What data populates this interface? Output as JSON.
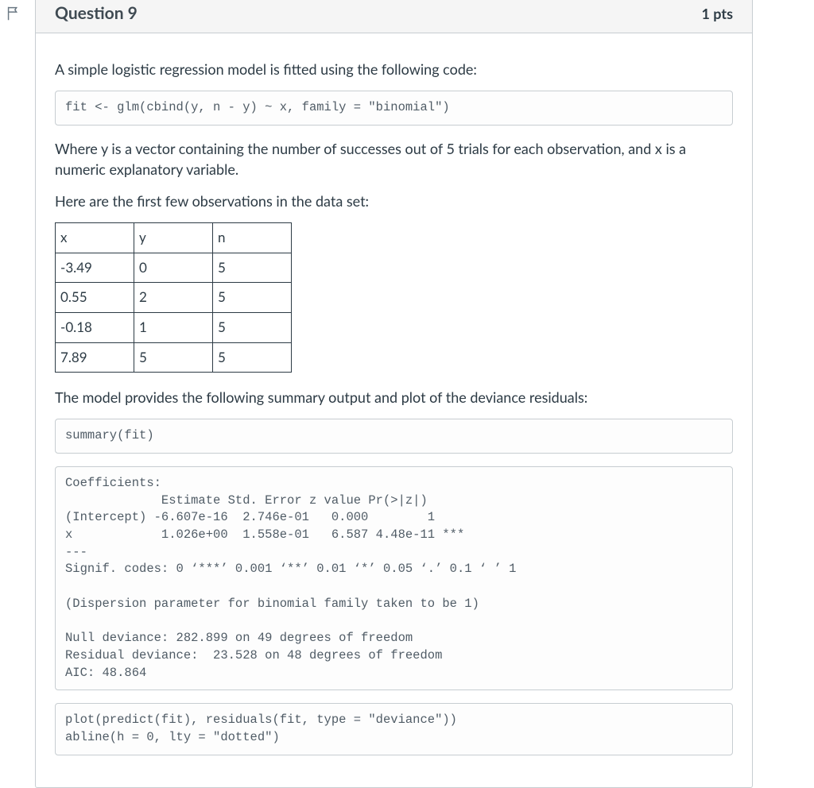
{
  "header": {
    "title": "Question 9",
    "points": "1 pts"
  },
  "body": {
    "intro": "A simple logistic regression model is fitted using the following code:",
    "code1": "fit <- glm(cbind(y, n - y) ~ x, family = \"binomial\")",
    "para1": "Where y is a vector containing the number of successes out of 5 trials for each observation, and x is a numeric explanatory variable.",
    "para2": "Here are the first few observations in the data set:",
    "table": {
      "headers": [
        "x",
        "y",
        "n"
      ],
      "rows": [
        [
          "-3.49",
          "0",
          "5"
        ],
        [
          "0.55",
          "2",
          "5"
        ],
        [
          "-0.18",
          "1",
          "5"
        ],
        [
          "7.89",
          "5",
          "5"
        ]
      ]
    },
    "para3": "The model provides the following summary output and plot of the deviance residuals:",
    "code2": "summary(fit)",
    "code3": "Coefficients:\n             Estimate Std. Error z value Pr(>|z|)\n(Intercept) -6.607e-16  2.746e-01   0.000        1\nx            1.026e+00  1.558e-01   6.587 4.48e-11 ***\n---\nSignif. codes: 0 ‘***’ 0.001 ‘**’ 0.01 ‘*’ 0.05 ‘.’ 0.1 ‘ ’ 1\n\n(Dispersion parameter for binomial family taken to be 1)\n\nNull deviance: 282.899 on 49 degrees of freedom\nResidual deviance:  23.528 on 48 degrees of freedom\nAIC: 48.864",
    "code4": "plot(predict(fit), residuals(fit, type = \"deviance\"))\nabline(h = 0, lty = \"dotted\")"
  }
}
